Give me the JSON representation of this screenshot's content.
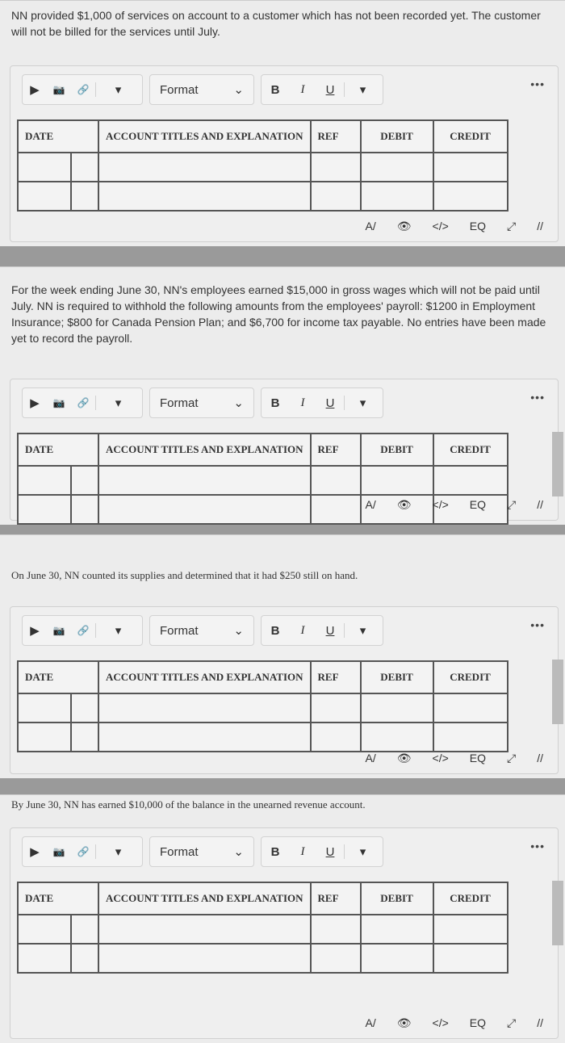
{
  "toolbar": {
    "format_label": "Format",
    "bold": "B",
    "italic": "I",
    "underline": "U",
    "more": "•••",
    "media_icon": "▶",
    "image_icon": "📷",
    "link_icon": "🔗",
    "dropdown_icon": "▾",
    "chevron_icon": "⌄"
  },
  "table_headers": {
    "date": "DATE",
    "account": "ACCOUNT TITLES AND EXPLANATION",
    "ref": "REF",
    "debit": "DEBIT",
    "credit": "CREDIT"
  },
  "bottom_icons": [
    "A/",
    "👁",
    "</>",
    "EQ",
    "⤢",
    "//"
  ],
  "questions": [
    {
      "text": "NN provided $1,000 of services on account to a customer which has not been recorded yet.  The customer will not be billed for the services until July."
    },
    {
      "text": "For the week ending June 30, NN's employees earned $15,000 in gross wages which will not be paid until July.  NN is required to withhold the following amounts from the employees' payroll:  $1200 in Employment Insurance; $800 for Canada Pension Plan; and $6,700 for income tax payable.  No entries have been made yet to record the payroll."
    },
    {
      "text": "On June 30, NN counted its supplies and determined that it had $250 still on hand."
    },
    {
      "text": "By June 30, NN has earned $10,000 of the balance in the unearned revenue account."
    }
  ]
}
